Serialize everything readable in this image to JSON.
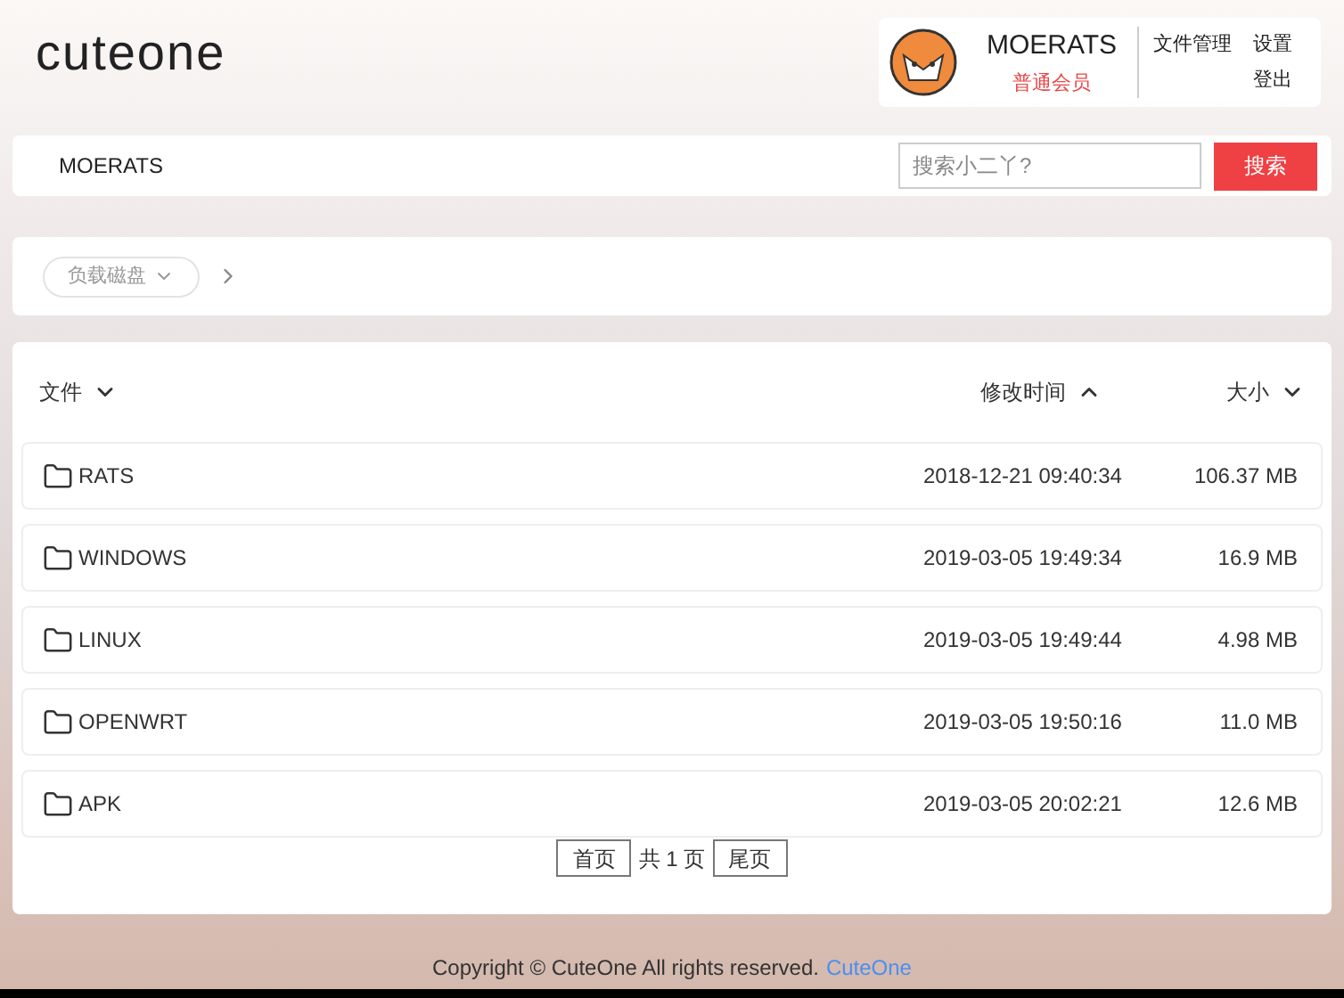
{
  "logo": "cuteone",
  "user": {
    "name": "MOERATS",
    "role": "普通会员",
    "links": [
      "文件管理",
      "设置",
      "登出"
    ]
  },
  "nav": {
    "title": "MOERATS",
    "search": {
      "placeholder": "搜索小二丫?"
    },
    "search_button": "搜索"
  },
  "breadcrumb": {
    "drive": "负载磁盘"
  },
  "table": {
    "columns": [
      {
        "label": "文件",
        "sort_ascending": false
      },
      {
        "label": "修改时间",
        "sort_ascending": true
      },
      {
        "label": "大小",
        "sort_ascending": false
      }
    ],
    "rows": [
      {
        "name": "RATS",
        "modified": "2018-12-21 09:40:34",
        "size": "106.37 MB"
      },
      {
        "name": "WINDOWS",
        "modified": "2019-03-05 19:49:34",
        "size": "16.9 MB"
      },
      {
        "name": "LINUX",
        "modified": "2019-03-05 19:49:44",
        "size": "4.98 MB"
      },
      {
        "name": "OPENWRT",
        "modified": "2019-03-05 19:50:16",
        "size": "11.0 MB"
      },
      {
        "name": "APK",
        "modified": "2019-03-05 20:02:21",
        "size": "12.6 MB"
      }
    ]
  },
  "pagination": {
    "first": "首页",
    "info": "共 1 页",
    "last": "尾页"
  },
  "footer": {
    "text": "Copyright © CuteOne All rights reserved.",
    "link": "CuteOne"
  }
}
